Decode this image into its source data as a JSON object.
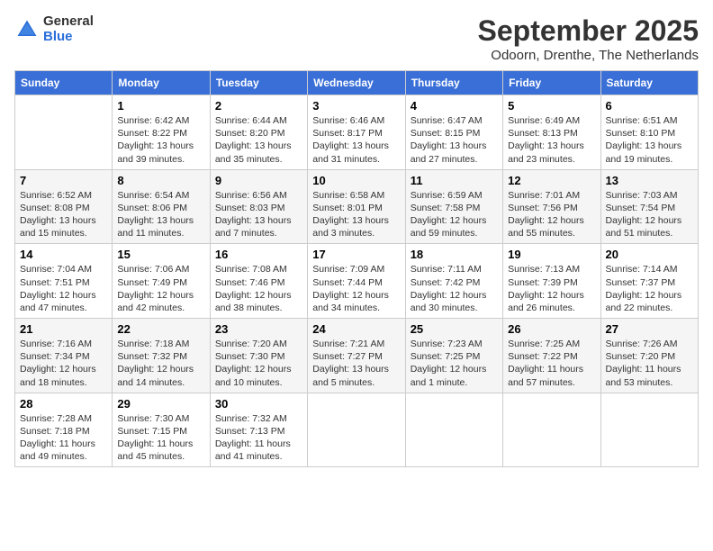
{
  "header": {
    "logo": {
      "general": "General",
      "blue": "Blue"
    },
    "title": "September 2025",
    "subtitle": "Odoorn, Drenthe, The Netherlands"
  },
  "calendar": {
    "days_of_week": [
      "Sunday",
      "Monday",
      "Tuesday",
      "Wednesday",
      "Thursday",
      "Friday",
      "Saturday"
    ],
    "weeks": [
      [
        {
          "day": "",
          "info": ""
        },
        {
          "day": "1",
          "info": "Sunrise: 6:42 AM\nSunset: 8:22 PM\nDaylight: 13 hours\nand 39 minutes."
        },
        {
          "day": "2",
          "info": "Sunrise: 6:44 AM\nSunset: 8:20 PM\nDaylight: 13 hours\nand 35 minutes."
        },
        {
          "day": "3",
          "info": "Sunrise: 6:46 AM\nSunset: 8:17 PM\nDaylight: 13 hours\nand 31 minutes."
        },
        {
          "day": "4",
          "info": "Sunrise: 6:47 AM\nSunset: 8:15 PM\nDaylight: 13 hours\nand 27 minutes."
        },
        {
          "day": "5",
          "info": "Sunrise: 6:49 AM\nSunset: 8:13 PM\nDaylight: 13 hours\nand 23 minutes."
        },
        {
          "day": "6",
          "info": "Sunrise: 6:51 AM\nSunset: 8:10 PM\nDaylight: 13 hours\nand 19 minutes."
        }
      ],
      [
        {
          "day": "7",
          "info": "Sunrise: 6:52 AM\nSunset: 8:08 PM\nDaylight: 13 hours\nand 15 minutes."
        },
        {
          "day": "8",
          "info": "Sunrise: 6:54 AM\nSunset: 8:06 PM\nDaylight: 13 hours\nand 11 minutes."
        },
        {
          "day": "9",
          "info": "Sunrise: 6:56 AM\nSunset: 8:03 PM\nDaylight: 13 hours\nand 7 minutes."
        },
        {
          "day": "10",
          "info": "Sunrise: 6:58 AM\nSunset: 8:01 PM\nDaylight: 13 hours\nand 3 minutes."
        },
        {
          "day": "11",
          "info": "Sunrise: 6:59 AM\nSunset: 7:58 PM\nDaylight: 12 hours\nand 59 minutes."
        },
        {
          "day": "12",
          "info": "Sunrise: 7:01 AM\nSunset: 7:56 PM\nDaylight: 12 hours\nand 55 minutes."
        },
        {
          "day": "13",
          "info": "Sunrise: 7:03 AM\nSunset: 7:54 PM\nDaylight: 12 hours\nand 51 minutes."
        }
      ],
      [
        {
          "day": "14",
          "info": "Sunrise: 7:04 AM\nSunset: 7:51 PM\nDaylight: 12 hours\nand 47 minutes."
        },
        {
          "day": "15",
          "info": "Sunrise: 7:06 AM\nSunset: 7:49 PM\nDaylight: 12 hours\nand 42 minutes."
        },
        {
          "day": "16",
          "info": "Sunrise: 7:08 AM\nSunset: 7:46 PM\nDaylight: 12 hours\nand 38 minutes."
        },
        {
          "day": "17",
          "info": "Sunrise: 7:09 AM\nSunset: 7:44 PM\nDaylight: 12 hours\nand 34 minutes."
        },
        {
          "day": "18",
          "info": "Sunrise: 7:11 AM\nSunset: 7:42 PM\nDaylight: 12 hours\nand 30 minutes."
        },
        {
          "day": "19",
          "info": "Sunrise: 7:13 AM\nSunset: 7:39 PM\nDaylight: 12 hours\nand 26 minutes."
        },
        {
          "day": "20",
          "info": "Sunrise: 7:14 AM\nSunset: 7:37 PM\nDaylight: 12 hours\nand 22 minutes."
        }
      ],
      [
        {
          "day": "21",
          "info": "Sunrise: 7:16 AM\nSunset: 7:34 PM\nDaylight: 12 hours\nand 18 minutes."
        },
        {
          "day": "22",
          "info": "Sunrise: 7:18 AM\nSunset: 7:32 PM\nDaylight: 12 hours\nand 14 minutes."
        },
        {
          "day": "23",
          "info": "Sunrise: 7:20 AM\nSunset: 7:30 PM\nDaylight: 12 hours\nand 10 minutes."
        },
        {
          "day": "24",
          "info": "Sunrise: 7:21 AM\nSunset: 7:27 PM\nDaylight: 13 hours\nand 5 minutes."
        },
        {
          "day": "25",
          "info": "Sunrise: 7:23 AM\nSunset: 7:25 PM\nDaylight: 12 hours\nand 1 minute."
        },
        {
          "day": "26",
          "info": "Sunrise: 7:25 AM\nSunset: 7:22 PM\nDaylight: 11 hours\nand 57 minutes."
        },
        {
          "day": "27",
          "info": "Sunrise: 7:26 AM\nSunset: 7:20 PM\nDaylight: 11 hours\nand 53 minutes."
        }
      ],
      [
        {
          "day": "28",
          "info": "Sunrise: 7:28 AM\nSunset: 7:18 PM\nDaylight: 11 hours\nand 49 minutes."
        },
        {
          "day": "29",
          "info": "Sunrise: 7:30 AM\nSunset: 7:15 PM\nDaylight: 11 hours\nand 45 minutes."
        },
        {
          "day": "30",
          "info": "Sunrise: 7:32 AM\nSunset: 7:13 PM\nDaylight: 11 hours\nand 41 minutes."
        },
        {
          "day": "",
          "info": ""
        },
        {
          "day": "",
          "info": ""
        },
        {
          "day": "",
          "info": ""
        },
        {
          "day": "",
          "info": ""
        }
      ]
    ]
  }
}
